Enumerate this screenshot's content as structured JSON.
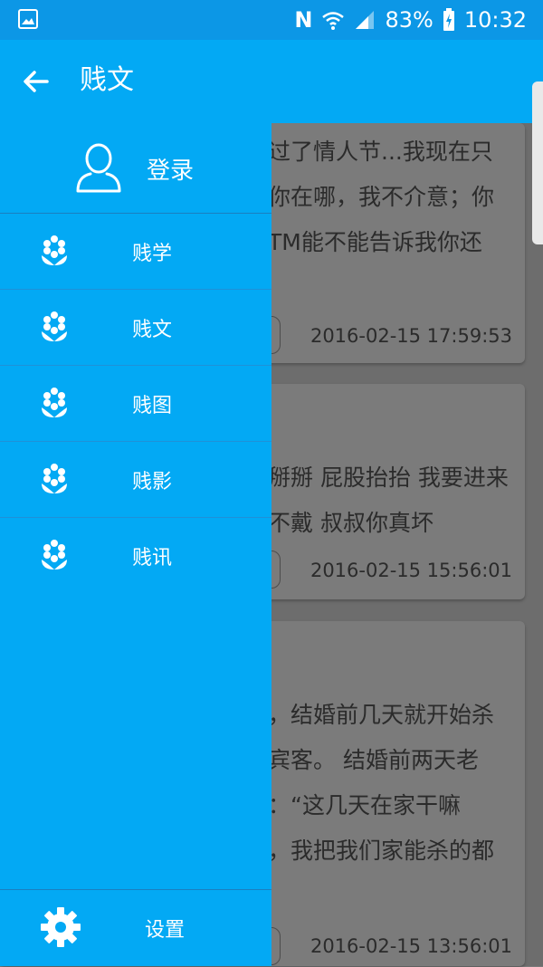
{
  "status_bar": {
    "network_letter": "N",
    "battery": "83%",
    "time": "10:32"
  },
  "app_bar": {
    "title": "贱文"
  },
  "drawer": {
    "login_label": "登录",
    "menu": [
      {
        "label": "贱学"
      },
      {
        "label": "贱文"
      },
      {
        "label": "贱图"
      },
      {
        "label": "贱影"
      },
      {
        "label": "贱讯"
      }
    ],
    "settings_label": "设置"
  },
  "feed": {
    "cards": [
      {
        "lines": [
          "过了情人节...我现在只",
          "你在哪，我不介意；你",
          "TM能不能告诉我你还"
        ],
        "time": "2016-02-15 17:59:53"
      },
      {
        "lines": [
          "掰掰 屁股抬抬 我要进来",
          "不戴 叔叔你真坏"
        ],
        "time": "2016-02-15 15:56:01"
      },
      {
        "lines": [
          "，结婚前几天就开始杀",
          "宾客。 结婚前两天老",
          "：“这几天在家干嘛",
          "，我把我们家能杀的都"
        ],
        "time": "2016-02-15 13:56:01"
      }
    ]
  },
  "colors": {
    "primary": "#03a9f4",
    "status_bar": "#0c97e6",
    "scrim": "#6d6d6d"
  }
}
